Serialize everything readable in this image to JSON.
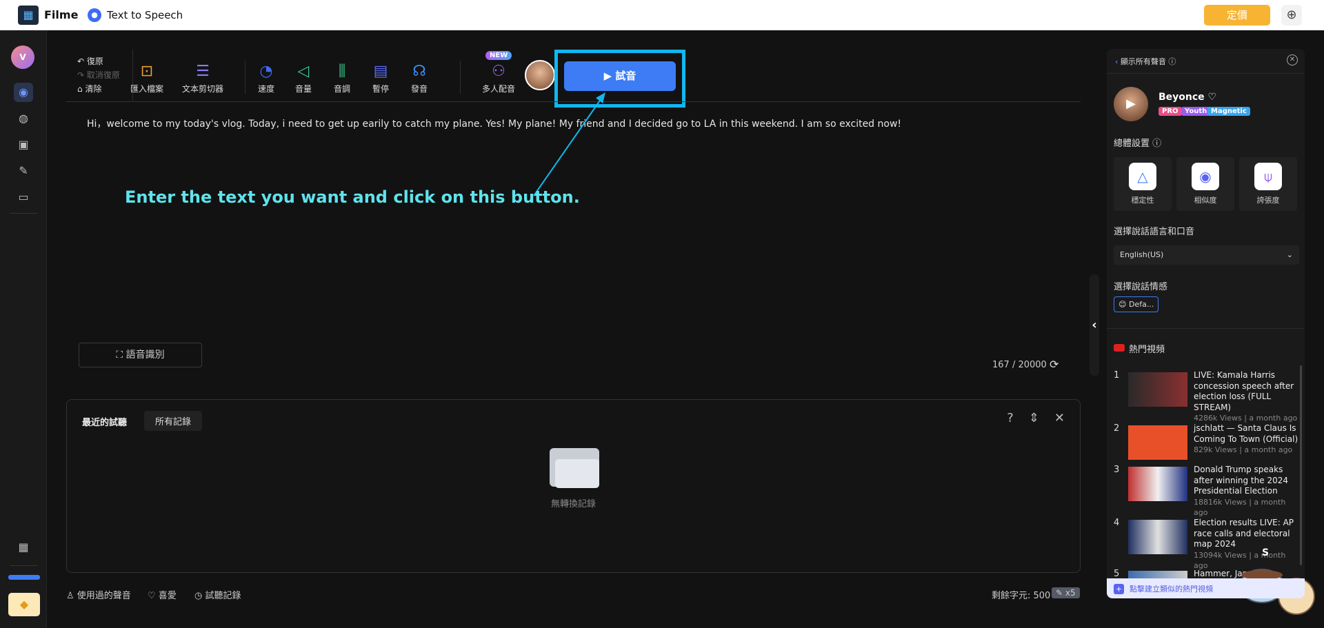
{
  "topbar": {
    "brand": "Filme",
    "app": "Text to Speech",
    "pricing": "定價",
    "logo_icon": "film-icon",
    "globe_icon": "globe-icon"
  },
  "sidebar": {
    "avatar_letter": "V",
    "items": [
      "text-to-speech-icon",
      "audio-icon",
      "subtitle-icon",
      "edit-icon",
      "folder-icon"
    ],
    "grid_icon": "grid-icon",
    "premium_icon": "diamond-icon"
  },
  "toolbar": {
    "undo": "復原",
    "redo": "取消復原",
    "clear": "清除",
    "tools": [
      {
        "label": "匯入檔案",
        "icon": "import-file-icon",
        "color": "#f0a030"
      },
      {
        "label": "文本剪切器",
        "icon": "text-cutter-icon",
        "color": "#8a7cf5"
      },
      {
        "label": "速度",
        "icon": "speed-icon",
        "color": "#3d6cf5"
      },
      {
        "label": "音量",
        "icon": "volume-icon",
        "color": "#3cc890"
      },
      {
        "label": "音調",
        "icon": "pitch-icon",
        "color": "#3cc890"
      },
      {
        "label": "暫停",
        "icon": "pause-icon",
        "color": "#5a6cf5"
      },
      {
        "label": "發音",
        "icon": "pronunciation-icon",
        "color": "#3d8cf5"
      }
    ],
    "multi_voice": "多人配音",
    "new_badge": "NEW",
    "try_button": "試音"
  },
  "editor": {
    "text": "Hi，welcome to my today's vlog. Today, i need to get up earily to catch my plane. Yes! My plane! My friend and I decided go to LA in this weekend. I am so excited now!",
    "char_count": "167 / 20000",
    "voice_recognition": "語音識別"
  },
  "annotation": {
    "text": "Enter the text you want and click on this button.",
    "color": "#5ee3ec",
    "highlight_color": "#11b7ef"
  },
  "history": {
    "title": "最近的試聽",
    "tab": "所有記錄",
    "empty": "無轉換記錄"
  },
  "footer": {
    "used_voices": "使用過的聲音",
    "favorites": "喜愛",
    "history": "試聽記錄",
    "remaining": "剩餘字元: 500",
    "multiplier": "x5"
  },
  "right_panel": {
    "back": "顯示所有聲音",
    "voice_name": "Beyonce",
    "tags": [
      {
        "label": "PRO",
        "color": "#e8508a"
      },
      {
        "label": "Youth",
        "color": "#9a5cf0"
      },
      {
        "label": "Magnetic",
        "color": "#3aa6f0"
      }
    ],
    "overall_settings": "總體設置",
    "settings": [
      {
        "label": "穩定性",
        "icon": "stability-icon"
      },
      {
        "label": "相似度",
        "icon": "similarity-icon"
      },
      {
        "label": "誇張度",
        "icon": "exaggeration-icon"
      }
    ],
    "language_label": "選擇說話語言和口音",
    "language_value": "English(US)",
    "emotion_label": "選擇說話情感",
    "emotion_value": "😊 Defa...",
    "trending_label": "熱門視頻",
    "videos": [
      {
        "num": "1",
        "title": "LIVE: Kamala Harris concession speech after election loss (FULL STREAM)",
        "meta": "4286k Views | a month ago"
      },
      {
        "num": "2",
        "title": "jschlatt — Santa Claus Is Coming To Town (Official)",
        "meta": "829k Views | a month ago"
      },
      {
        "num": "3",
        "title": "Donald Trump speaks after winning the 2024 Presidential Election",
        "meta": "18816k Views | a month ago"
      },
      {
        "num": "4",
        "title": "Election results LIVE: AP race calls and electoral map 2024",
        "meta": "13094k Views | a month ago"
      },
      {
        "num": "5",
        "title": "Hammer, Jam F...",
        "meta": ""
      }
    ],
    "create_similar": "點擊建立類似的熱門視頻"
  }
}
